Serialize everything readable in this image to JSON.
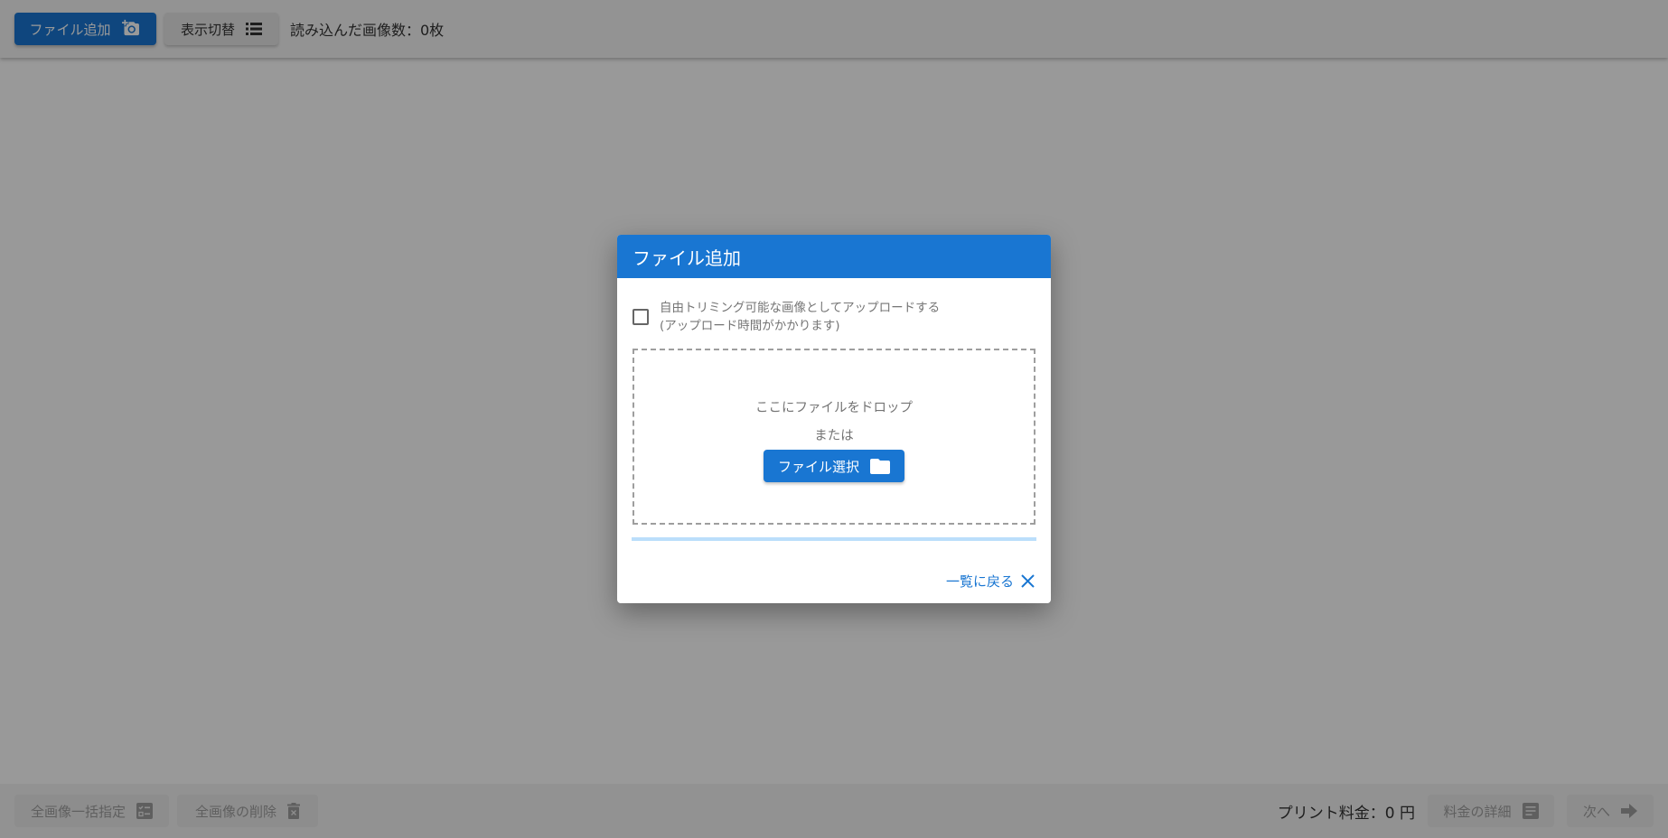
{
  "topbar": {
    "add_file_label": "ファイル追加",
    "toggle_view_label": "表示切替",
    "image_count_text": "読み込んだ画像数：0枚"
  },
  "bottombar": {
    "bulk_assign_label": "全画像一括指定",
    "delete_all_label": "全画像の削除",
    "price_text": "プリント料金：0 円",
    "price_details_label": "料金の詳細",
    "next_label": "次へ"
  },
  "dialog": {
    "title": "ファイル追加",
    "checkbox_line1": "自由トリミング可能な画像としてアップロードする",
    "checkbox_line2": "(アップロード時間がかかります)",
    "drop_text": "ここにファイルをドロップ",
    "or_text": "または",
    "select_file_label": "ファイル選択",
    "back_label": "一覧に戻る"
  },
  "colors": {
    "primary": "#1976d2",
    "overlay": "rgba(0,0,0,0.40)"
  },
  "icons": {
    "add_photo": "add-photo-icon",
    "list": "list-icon",
    "checklist": "checklist-icon",
    "delete": "trash-icon",
    "receipt": "receipt-icon",
    "arrow_right": "arrow-right-icon",
    "folder": "folder-icon",
    "close": "close-icon"
  }
}
